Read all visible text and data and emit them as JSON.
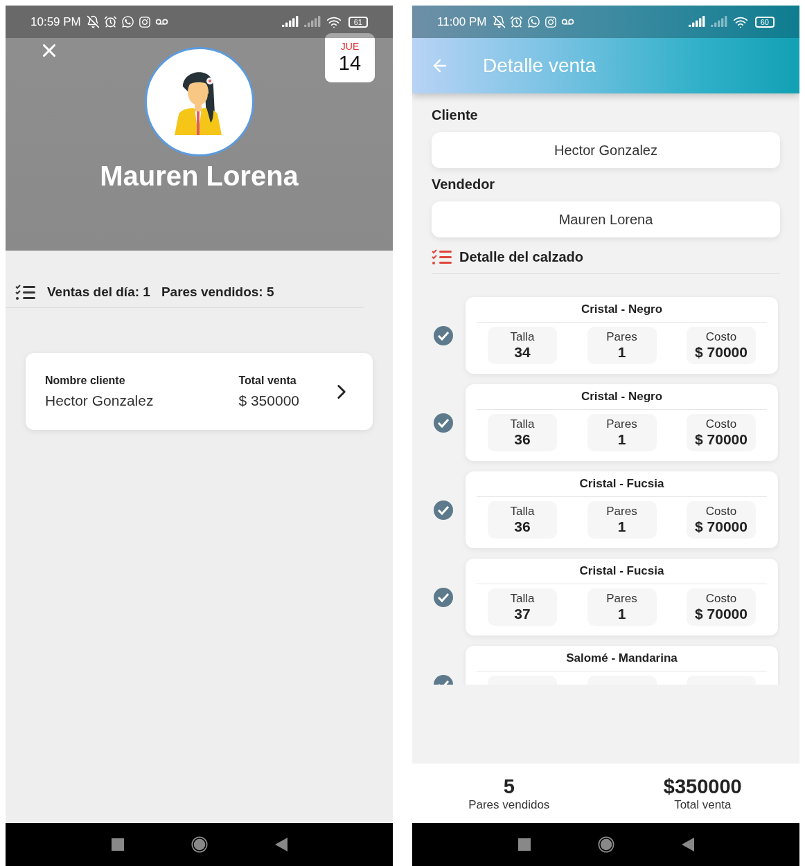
{
  "sales_summary": {
    "status_bar": {
      "time": "10:59 PM",
      "battery": "61"
    },
    "seller_name": "Mauren Lorena",
    "calendar": {
      "weekday": "JUE",
      "day": "14"
    },
    "stats": [
      "Ventas del día: 1",
      "Pares vendidos: 5"
    ],
    "sales": [
      {
        "client_label": "Nombre cliente",
        "client": "Hector Gonzalez",
        "total_label": "Total venta",
        "total": "$ 350000"
      }
    ]
  },
  "sale_detail": {
    "status_bar": {
      "time": "11:00 PM",
      "battery": "60"
    },
    "title": "Detalle venta",
    "fields": [
      {
        "label": "Cliente",
        "value": "Hector Gonzalez"
      },
      {
        "label": "Vendedor",
        "value": "Mauren Lorena"
      }
    ],
    "section_title": "Detalle del calzado",
    "items": [
      {
        "checked": true,
        "name": "Cristal - Negro",
        "cells": [
          {
            "label": "Talla",
            "value": "34"
          },
          {
            "label": "Pares",
            "value": "1"
          },
          {
            "label": "Costo",
            "value": "$ 70000"
          }
        ]
      },
      {
        "checked": true,
        "name": "Cristal - Negro",
        "cells": [
          {
            "label": "Talla",
            "value": "36"
          },
          {
            "label": "Pares",
            "value": "1"
          },
          {
            "label": "Costo",
            "value": "$ 70000"
          }
        ]
      },
      {
        "checked": true,
        "name": "Cristal - Fucsia",
        "cells": [
          {
            "label": "Talla",
            "value": "36"
          },
          {
            "label": "Pares",
            "value": "1"
          },
          {
            "label": "Costo",
            "value": "$ 70000"
          }
        ]
      },
      {
        "checked": true,
        "name": "Cristal - Fucsia",
        "cells": [
          {
            "label": "Talla",
            "value": "37"
          },
          {
            "label": "Pares",
            "value": "1"
          },
          {
            "label": "Costo",
            "value": "$ 70000"
          }
        ]
      },
      {
        "checked": true,
        "name": "Salomé - Mandarina"
      }
    ],
    "footer": [
      {
        "value": "5",
        "label": "Pares vendidos"
      },
      {
        "value": "$350000",
        "label": "Total venta"
      }
    ]
  }
}
